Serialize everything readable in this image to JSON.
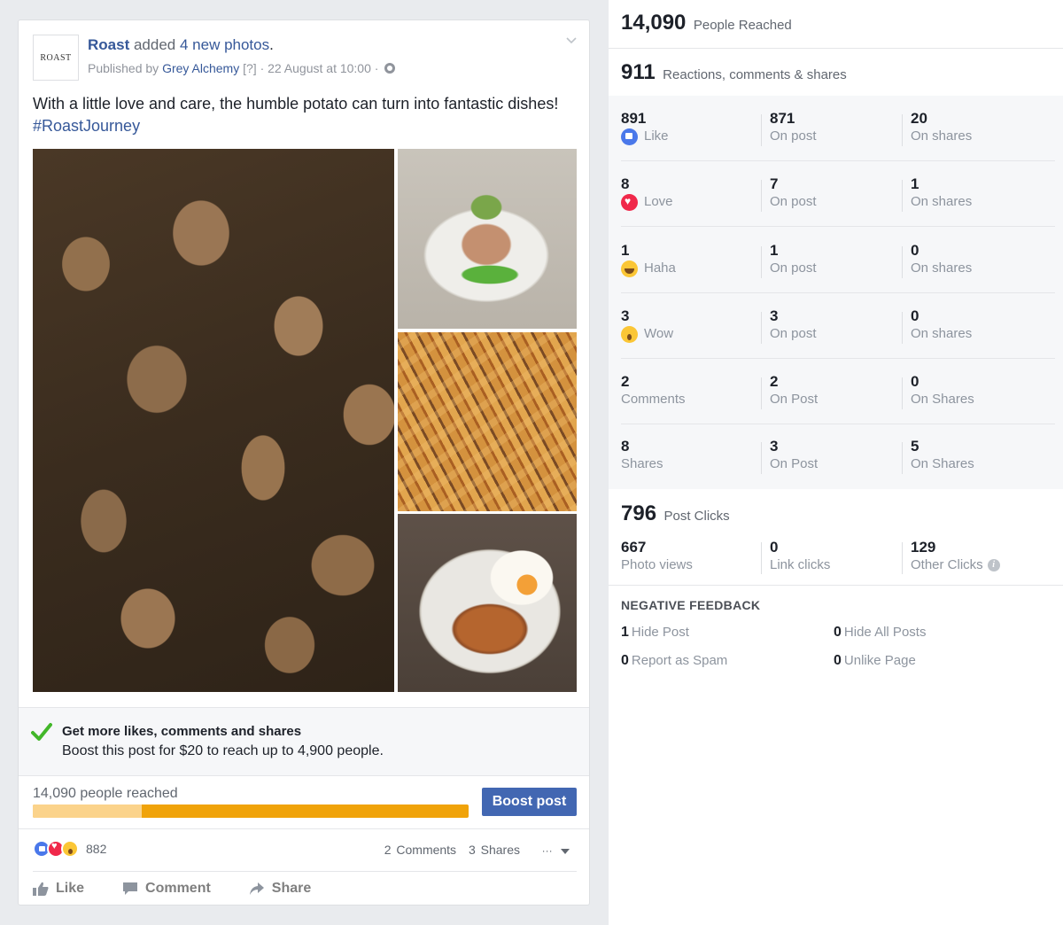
{
  "post": {
    "logo_text": "ROAST",
    "page_name": "Roast",
    "action_text": "added",
    "photos_text": "4 new photos",
    "period": ".",
    "published_by": "Published by",
    "publisher": "Grey Alchemy",
    "help_mark": "[?]",
    "date": "· 22 August at 10:00 ·",
    "caption": "With a little love and care, the humble potato can turn into fantastic dishes!",
    "hashtag": "#RoastJourney",
    "photos": [
      "potatoes-photo",
      "plated-dish-photo",
      "fries-photo",
      "egg-dish-photo"
    ]
  },
  "boost": {
    "title": "Get more likes, comments and shares",
    "description": "Boost this post for $20 to reach up to 4,900 people.",
    "reached_label": "14,090 people reached",
    "organic_fraction": 0.25,
    "button_label": "Boost post",
    "colors": {
      "button": "#4267b2",
      "bar": "#f0a30a",
      "bar_light": "#fbd38b"
    }
  },
  "engagement": {
    "reaction_count": "882",
    "comments": "2 Comments",
    "shares": "3 Shares",
    "menu": "···"
  },
  "actions": {
    "like": "Like",
    "comment": "Comment",
    "share": "Share"
  },
  "insights": {
    "reached": {
      "value": "14,090",
      "label": "People Reached"
    },
    "reactions_total": {
      "value": "911",
      "label": "Reactions, comments & shares"
    },
    "rows": [
      {
        "total": "891",
        "label": "Like",
        "icon": "like-icon",
        "on_post": "871",
        "on_post_label": "On post",
        "on_shares": "20",
        "on_shares_label": "On shares"
      },
      {
        "total": "8",
        "label": "Love",
        "icon": "love-icon",
        "on_post": "7",
        "on_post_label": "On post",
        "on_shares": "1",
        "on_shares_label": "On shares"
      },
      {
        "total": "1",
        "label": "Haha",
        "icon": "haha-icon",
        "on_post": "1",
        "on_post_label": "On post",
        "on_shares": "0",
        "on_shares_label": "On shares"
      },
      {
        "total": "3",
        "label": "Wow",
        "icon": "wow-icon",
        "on_post": "3",
        "on_post_label": "On post",
        "on_shares": "0",
        "on_shares_label": "On shares"
      },
      {
        "total": "2",
        "label": "Comments",
        "icon": "",
        "on_post": "2",
        "on_post_label": "On Post",
        "on_shares": "0",
        "on_shares_label": "On Shares"
      },
      {
        "total": "8",
        "label": "Shares",
        "icon": "",
        "on_post": "3",
        "on_post_label": "On Post",
        "on_shares": "5",
        "on_shares_label": "On Shares"
      }
    ],
    "post_clicks": {
      "value": "796",
      "label": "Post Clicks"
    },
    "clicks": [
      {
        "value": "667",
        "label": "Photo views"
      },
      {
        "value": "0",
        "label": "Link clicks"
      },
      {
        "value": "129",
        "label": "Other Clicks"
      }
    ],
    "negative": {
      "title": "NEGATIVE FEEDBACK",
      "hide_post": {
        "value": "1",
        "label": "Hide Post"
      },
      "hide_all": {
        "value": "0",
        "label": "Hide All Posts"
      },
      "report_spam": {
        "value": "0",
        "label": "Report as Spam"
      },
      "unlike_page": {
        "value": "0",
        "label": "Unlike Page"
      }
    }
  }
}
